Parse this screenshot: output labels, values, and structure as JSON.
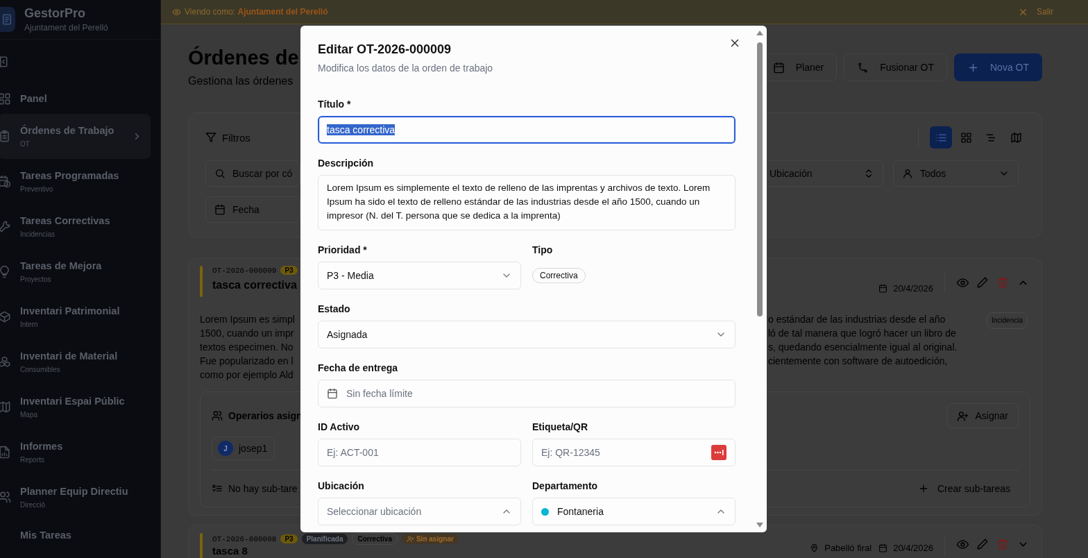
{
  "sidebar": {
    "app_name": "GestorPro",
    "org": "Ajuntament del Perelló",
    "items": [
      {
        "label": "Panel",
        "selected": false
      },
      {
        "label": "Órdenes de Trabajo",
        "sub": "OT",
        "selected": true
      },
      {
        "label": "Tareas Programadas",
        "sub": "Preventivo",
        "selected": false
      },
      {
        "label": "Tareas Correctivas",
        "sub": "Incidencias",
        "selected": false
      },
      {
        "label": "Tareas de Mejora",
        "sub": "Proyectos",
        "selected": false
      },
      {
        "label": "Inventari Patrimonial",
        "sub": "Intern",
        "selected": false
      },
      {
        "label": "Inventari de Material",
        "sub": "Consumibles",
        "selected": false
      },
      {
        "label": "Inventari Espai Públic",
        "sub": "Mapa",
        "selected": false
      },
      {
        "label": "Informes",
        "sub": "Reports",
        "selected": false
      },
      {
        "label": "Planner Equip Directiu",
        "sub": "Direcció",
        "selected": false
      },
      {
        "label": "Mis Tareas",
        "selected": false
      }
    ]
  },
  "banner": {
    "text": "Viendo como: **Ajuntament del Perelló**",
    "exit": "Salir"
  },
  "page": {
    "title": "Órdenes de",
    "subtitle": "Gestiona las órdenes",
    "actions": [
      {
        "label": "Planer",
        "primary": false
      },
      {
        "label": "Fusionar OT",
        "primary": false
      },
      {
        "label": "Nova OT",
        "primary": true
      }
    ]
  },
  "filters": {
    "title": "Filtros",
    "views": [
      {
        "selected": true
      },
      {
        "selected": false
      },
      {
        "selected": false
      },
      {
        "selected": false
      }
    ],
    "search_placeholder": "Buscar por có",
    "location_placeholder": "Ubicación",
    "assignee": "Todos",
    "date_placeholder": "Fecha"
  },
  "orders": [
    {
      "code": "OT-2026-000009",
      "priority": "P3",
      "title": "tasca correctiva",
      "date": "20/4/2026",
      "expanded": true,
      "description_left": [
        "Lorem Ipsum es simpl",
        "1500, cuando un impr",
        "textos especimen. No",
        "Fue popularizado en l",
        "como por ejemplo Ald"
      ],
      "description_right": [
        "o estándar de las industrias desde el año",
        "ló de tal manera que logró hacer un libro de",
        "s, quedando esencialmente igual al original.",
        "cientemente con software de autoedición,"
      ],
      "tag": "Incidencia",
      "operators_label": "Operarios asign",
      "operators": [
        {
          "initial": "J",
          "name": "josep1"
        }
      ],
      "assign": "Asignar",
      "subtasks_empty": "No hay sub-tare",
      "create_subtasks": "Crear sub-tareas"
    },
    {
      "code": "OT-2026-000008",
      "priority": "P3",
      "badges": [
        {
          "label": "Planificada",
          "kind": "status"
        },
        {
          "label": "Correctiva",
          "kind": "type"
        },
        {
          "label": "Sin asignar",
          "kind": "warning"
        }
      ],
      "title": "tasca 8",
      "location": "Pabelló firal",
      "date": "20/4/2026",
      "expanded": false
    }
  ],
  "modal": {
    "title": "Editar OT-2026-000009",
    "subtitle": "Modifica los datos de la orden de trabajo",
    "rows": [
      [
        {
          "kind": "text",
          "label": "Título *",
          "value": "tasca correctiva",
          "focused": true
        }
      ],
      [
        {
          "kind": "textarea",
          "label": "Descripción",
          "value": "Lorem Ipsum es simplemente el texto de relleno de las imprentas y archivos de texto. Lorem Ipsum ha sido el texto de relleno estándar de las industrias desde el año 1500, cuando un impresor (N. del T. persona que se dedica a la imprenta)"
        }
      ],
      [
        {
          "kind": "select",
          "label": "Prioridad *",
          "value": "P3 - Media"
        },
        {
          "kind": "tag",
          "label": "Tipo",
          "value": "Correctiva"
        }
      ],
      [
        {
          "kind": "select",
          "label": "Estado",
          "value": "Asignada"
        }
      ],
      [
        {
          "kind": "date",
          "label": "Fecha de entrega",
          "placeholder": "Sin fecha límite"
        }
      ],
      [
        {
          "kind": "text",
          "label": "ID Activo",
          "placeholder": "Ej: ACT-001"
        },
        {
          "kind": "qr",
          "label": "Etiqueta/QR",
          "placeholder": "Ej: QR-12345"
        }
      ],
      [
        {
          "kind": "combo",
          "label": "Ubicación",
          "placeholder": "Seleccionar ubicación"
        },
        {
          "kind": "combo",
          "label": "Departamento",
          "value": "Fontaneria",
          "color": "#06b6d4"
        }
      ]
    ]
  }
}
